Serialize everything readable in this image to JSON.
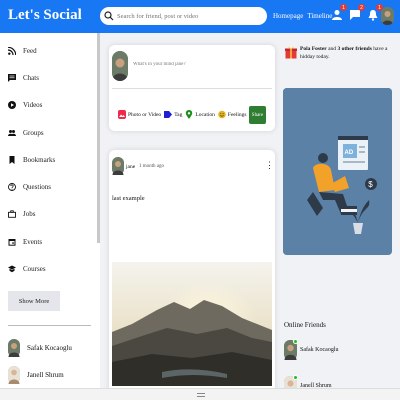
{
  "topbar": {
    "logo": "Let's Social",
    "search_placeholder": "Search for friend, post or video",
    "links": [
      "Homepage",
      "Timeline"
    ],
    "badges": [
      "1",
      "2",
      "1"
    ]
  },
  "sidebar": {
    "items": [
      {
        "label": "Feed",
        "icon": "rss-icon"
      },
      {
        "label": "Chats",
        "icon": "chat-icon"
      },
      {
        "label": "Videos",
        "icon": "play-icon"
      },
      {
        "label": "Groups",
        "icon": "group-icon"
      },
      {
        "label": "Bookmarks",
        "icon": "bookmark-icon"
      },
      {
        "label": "Questions",
        "icon": "question-icon"
      },
      {
        "label": "Jobs",
        "icon": "briefcase-icon"
      },
      {
        "label": "Events",
        "icon": "calendar-icon"
      },
      {
        "label": "Courses",
        "icon": "school-icon"
      }
    ],
    "show_more": "Show More",
    "friends": [
      "Safak Kocaoglu",
      "Janell Shrum"
    ]
  },
  "share": {
    "placeholder": "What's in your mind jane?",
    "options": [
      "Photo or Video",
      "Tag",
      "Location",
      "Feelings"
    ],
    "share_button": "Share"
  },
  "post": {
    "username": "jane",
    "time": "1 month ago",
    "text": "last example"
  },
  "rightbar": {
    "birthday_name": "Pola Foster",
    "birthday_mid": " and ",
    "birthday_others": "3 other friends",
    "birthday_end": " have a hidday today.",
    "online_title": "Online Friends",
    "online": [
      "Safak Kocaoglu",
      "Janell Shrum"
    ]
  },
  "colors": {
    "brand": "#1877f2",
    "share": "#2e7d32",
    "online": "#1dbf1d",
    "ad": "#5b82a6"
  }
}
